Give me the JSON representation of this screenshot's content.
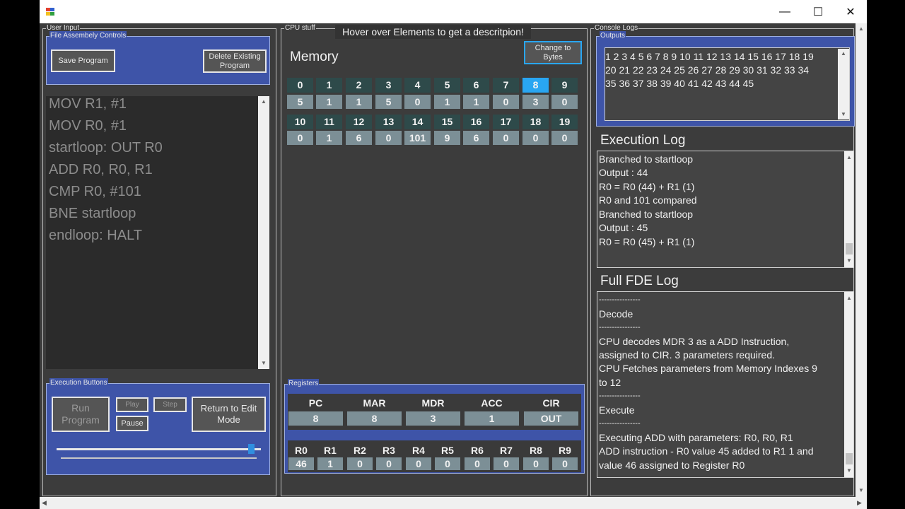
{
  "window": {
    "minimize": "—",
    "maximize": "☐",
    "close": "✕",
    "icon": "app-icon"
  },
  "tooltip": "Hover over Elements to get a descritpion!",
  "groups": {
    "user_input": "User Input",
    "file_controls": "File  Assembely Controls",
    "cpu": "CPU stuff",
    "console": "Console Logs",
    "execution_buttons": "Execution Buttons",
    "registers": "Registers",
    "outputs": "Outputs"
  },
  "file_controls": {
    "save": "Save Program",
    "delete_line1": "Delete Existing",
    "delete_line2": "Program"
  },
  "code": [
    "MOV R1, #1",
    "MOV R0, #1",
    "startloop: OUT R0",
    "ADD R0, R0, R1",
    "CMP R0, #101",
    "BNE  startloop",
    "endloop: HALT"
  ],
  "execution": {
    "run_line1": "Run",
    "run_line2": "Program",
    "play": "Play",
    "step": "Step",
    "pause": "Pause",
    "return_line1": "Return to Edit",
    "return_line2": "Mode",
    "speed_slider_value": 0.95
  },
  "memory": {
    "title": "Memory",
    "change_line1": "Change to",
    "change_line2": "Bytes",
    "highlighted_index": 8,
    "row1_idx": [
      "0",
      "1",
      "2",
      "3",
      "4",
      "5",
      "6",
      "7",
      "8",
      "9"
    ],
    "row1_val": [
      "5",
      "1",
      "1",
      "5",
      "0",
      "1",
      "1",
      "0",
      "3",
      "0"
    ],
    "row2_idx": [
      "10",
      "11",
      "12",
      "13",
      "14",
      "15",
      "16",
      "17",
      "18",
      "19"
    ],
    "row2_val": [
      "0",
      "1",
      "6",
      "0",
      "101",
      "9",
      "6",
      "0",
      "0",
      "0"
    ]
  },
  "registers": {
    "special_labels": [
      "PC",
      "MAR",
      "MDR",
      "ACC",
      "CIR"
    ],
    "special_values": [
      "8",
      "8",
      "3",
      "1",
      "OUT"
    ],
    "general_labels": [
      "R0",
      "R1",
      "R2",
      "R3",
      "R4",
      "R5",
      "R6",
      "R7",
      "R8",
      "R9"
    ],
    "general_values": [
      "46",
      "1",
      "0",
      "0",
      "0",
      "0",
      "0",
      "0",
      "0",
      "0"
    ]
  },
  "outputs": {
    "lines": [
      "1 2 3 4 5 6 7 8 9 10 11 12 13 14 15 16 17 18 19",
      "20 21 22 23 24 25 26 27 28 29 30 31 32 33 34",
      "35 36 37 38 39 40 41 42 43 44 45"
    ]
  },
  "execution_log": {
    "title": "Execution Log",
    "lines": [
      "Branched to startloop",
      "Output : 44",
      "R0 = R0 (44) + R1 (1)",
      "R0 and  101 compared",
      "Branched to startloop",
      "Output : 45",
      "R0 = R0 (45) + R1 (1)"
    ]
  },
  "fde_log": {
    "title": "Full FDE Log",
    "lines": [
      "----------------",
      "  Decode",
      "----------------",
      " CPU decodes MDR 3 as a ADD Instruction,",
      " assigned to CIR. 3 parameters required.",
      " CPU Fetches parameters from Memory Indexes 9",
      "to 12",
      "----------------",
      "  Execute",
      "----------------",
      "Executing ADD with parameters: R0, R0, R1",
      "ADD instruction -  R0 value 45 added to R1 1 and",
      "value 46 assigned to Register R0"
    ]
  }
}
